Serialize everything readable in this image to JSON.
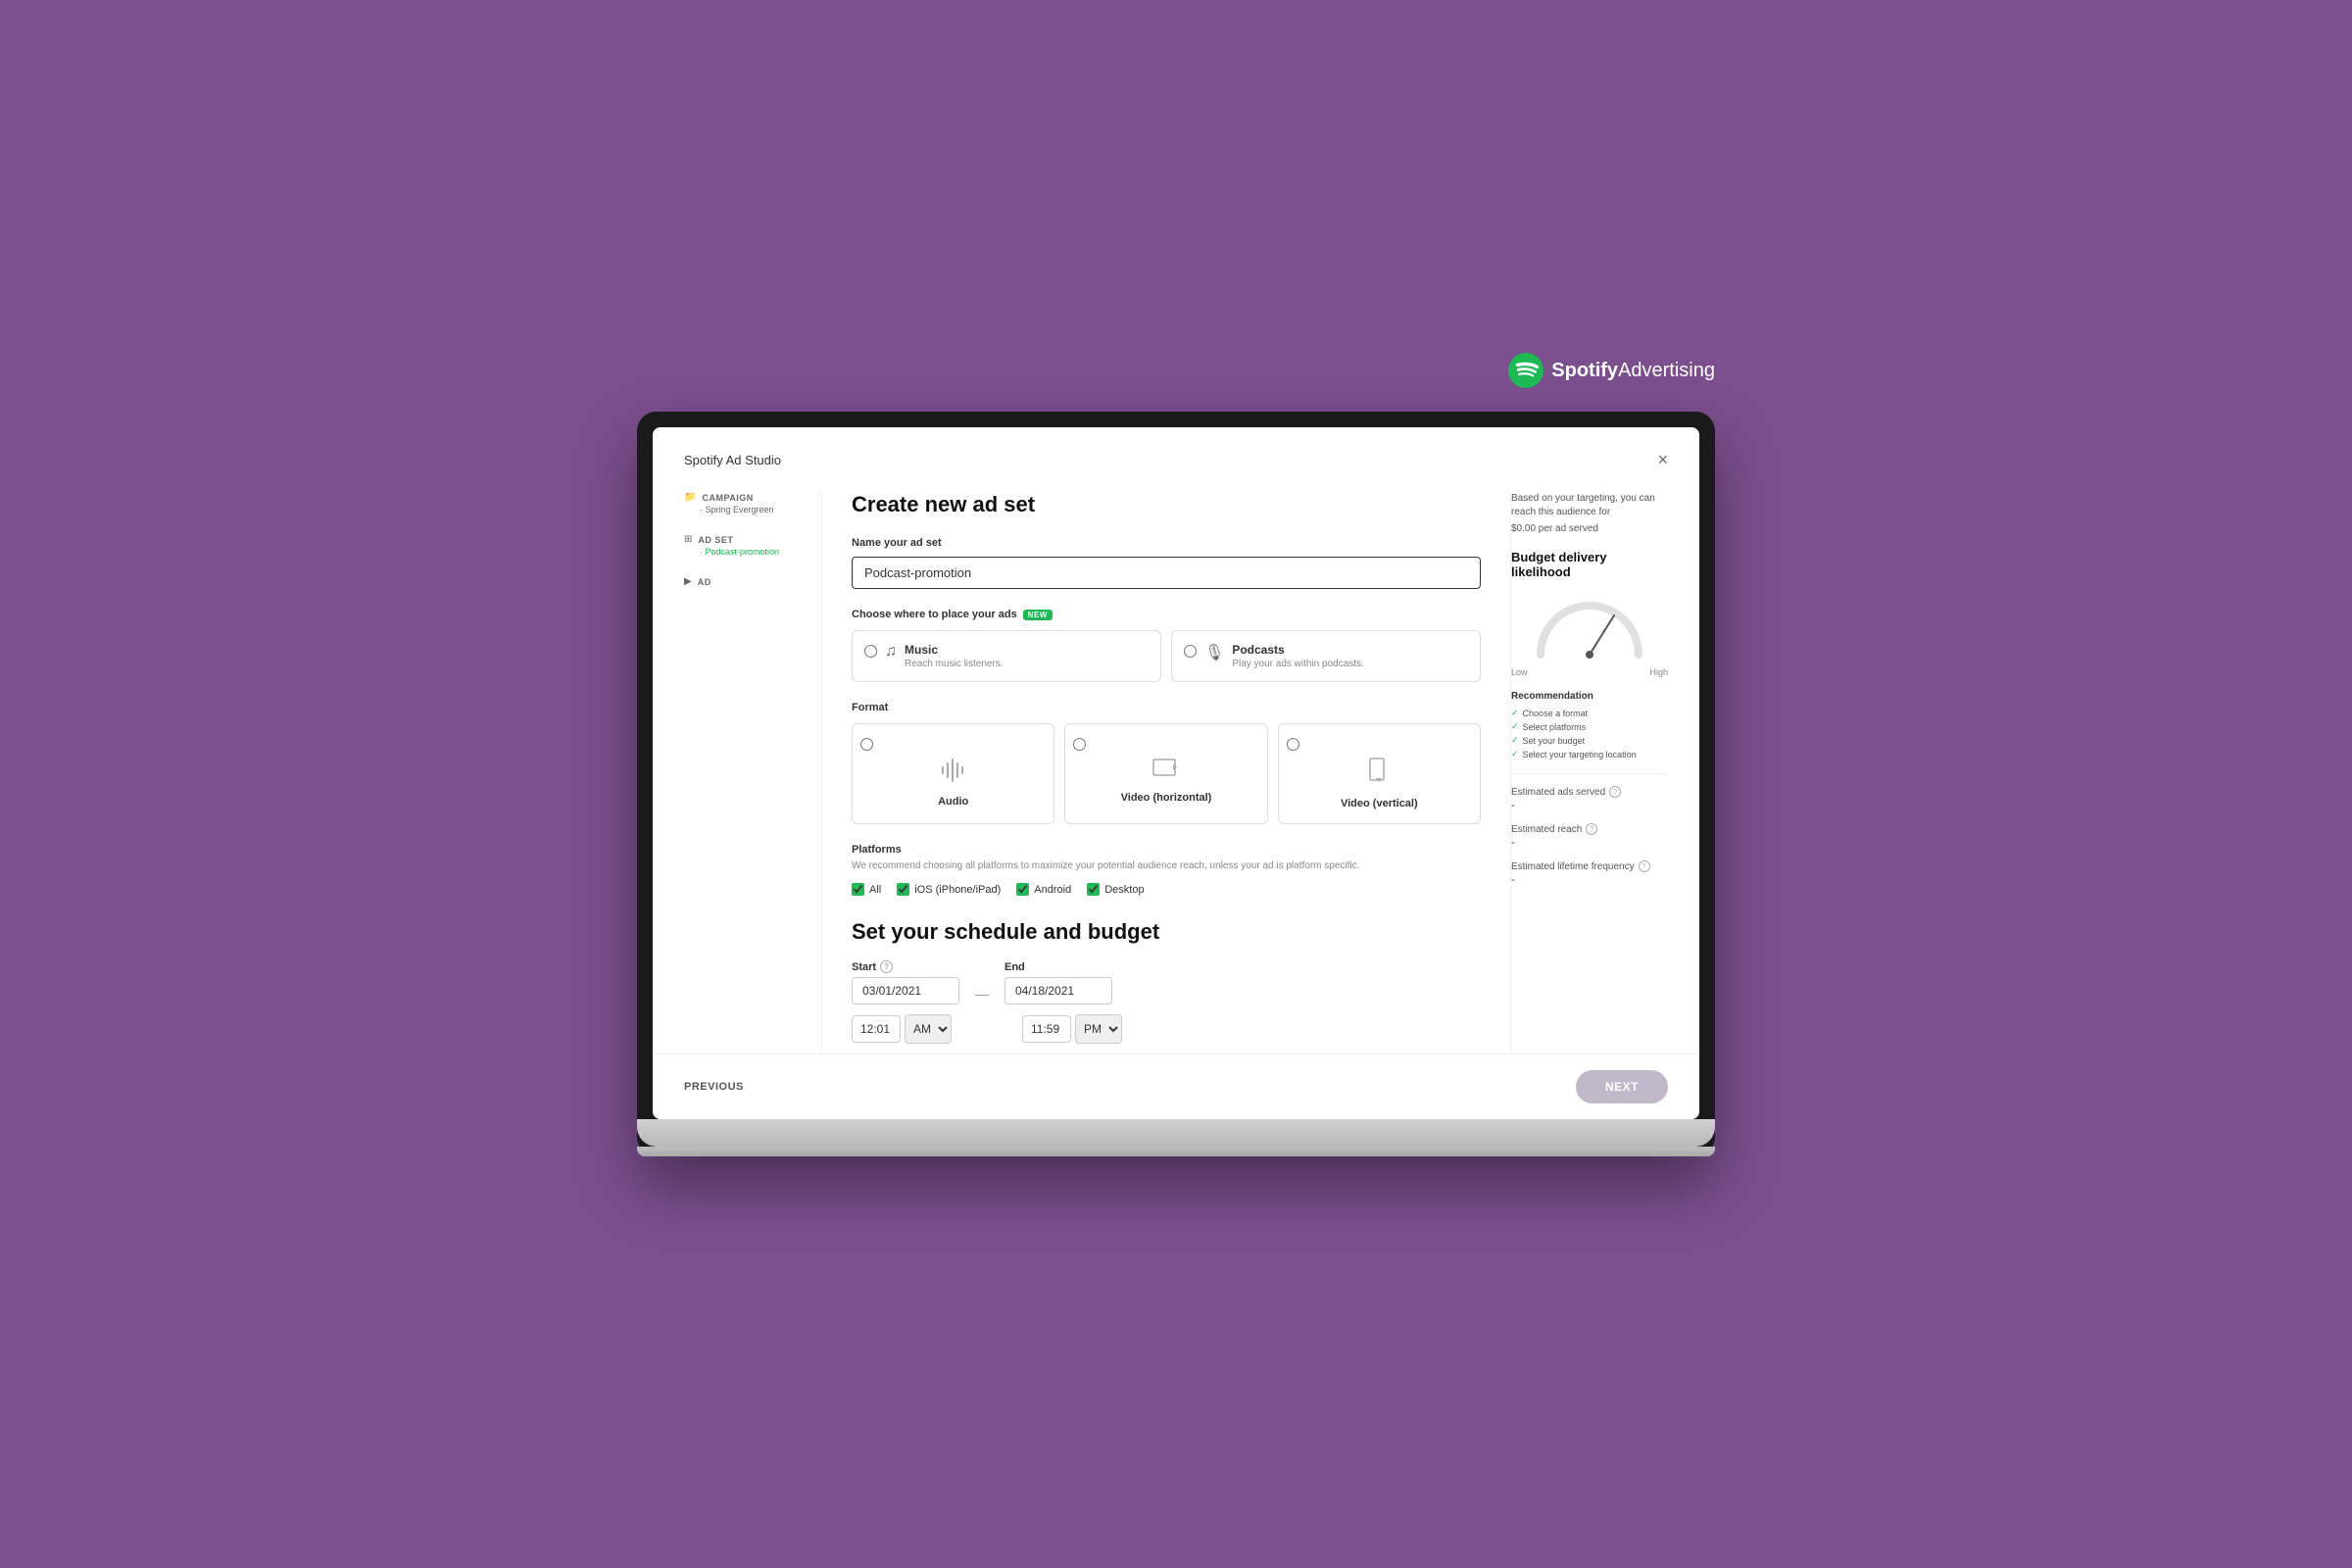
{
  "brand": {
    "logo_text": "Spotify",
    "logo_subtext": " Advertising"
  },
  "modal": {
    "title": "Spotify Ad Studio",
    "close_label": "×"
  },
  "sidebar": {
    "items": [
      {
        "id": "campaign",
        "icon": "📁",
        "label": "CAMPAIGN",
        "sublabel": "· Spring Evergreen"
      },
      {
        "id": "ad-set",
        "icon": "⊞",
        "label": "AD SET",
        "sublabel": "· Podcast-promotion"
      },
      {
        "id": "ad",
        "icon": "▶",
        "label": "AD",
        "sublabel": ""
      }
    ]
  },
  "form": {
    "title": "Create new ad set",
    "name_label": "Name your ad set",
    "name_value": "Podcast-promotion",
    "name_placeholder": "Podcast-promotion",
    "placement_label": "Choose where to place your ads",
    "new_badge": "NEW",
    "placement_options": [
      {
        "id": "music",
        "name": "Music",
        "description": "Reach music listeners.",
        "icon": "♫"
      },
      {
        "id": "podcasts",
        "name": "Podcasts",
        "description": "Play your ads within podcasts.",
        "icon": "🎙"
      }
    ],
    "format_label": "Format",
    "format_options": [
      {
        "id": "audio",
        "name": "Audio",
        "icon": "🎵"
      },
      {
        "id": "video-horizontal",
        "name": "Video (horizontal)",
        "icon": "📹"
      },
      {
        "id": "video-vertical",
        "name": "Video (vertical)",
        "icon": "📱"
      }
    ],
    "platforms_title": "Platforms",
    "platforms_desc": "We recommend choosing all platforms to maximize your potential audience reach, unless your ad is platform specific.",
    "platforms": [
      {
        "id": "all",
        "label": "All",
        "checked": true
      },
      {
        "id": "ios",
        "label": "iOS (iPhone/iPad)",
        "checked": true
      },
      {
        "id": "android",
        "label": "Android",
        "checked": true
      },
      {
        "id": "desktop",
        "label": "Desktop",
        "checked": true
      }
    ],
    "schedule_title": "Set your schedule and budget",
    "start_label": "Start",
    "start_date": "03/01/2021",
    "start_time": "12:01",
    "start_ampm": "AM",
    "end_label": "End",
    "end_date": "04/18/2021",
    "end_time": "11:59",
    "end_ampm": "PM"
  },
  "right_panel": {
    "reach_text": "Based on your targeting, you can reach this audience for",
    "price_text": "$0.00 per ad served",
    "budget_title": "Budget delivery likelihood",
    "gauge_low": "Low",
    "gauge_high": "High",
    "recommendation_title": "Recommendation",
    "recommendations": [
      "Choose a format",
      "Select platforms",
      "Set your budget",
      "Select your targeting location"
    ],
    "estimated_ads_label": "Estimated ads served",
    "estimated_ads_value": "-",
    "estimated_reach_label": "Estimated reach",
    "estimated_reach_value": "-",
    "estimated_frequency_label": "Estimated lifetime frequency",
    "estimated_frequency_value": "-"
  },
  "footer": {
    "previous_label": "PREVIOUS",
    "next_label": "NEXT"
  }
}
